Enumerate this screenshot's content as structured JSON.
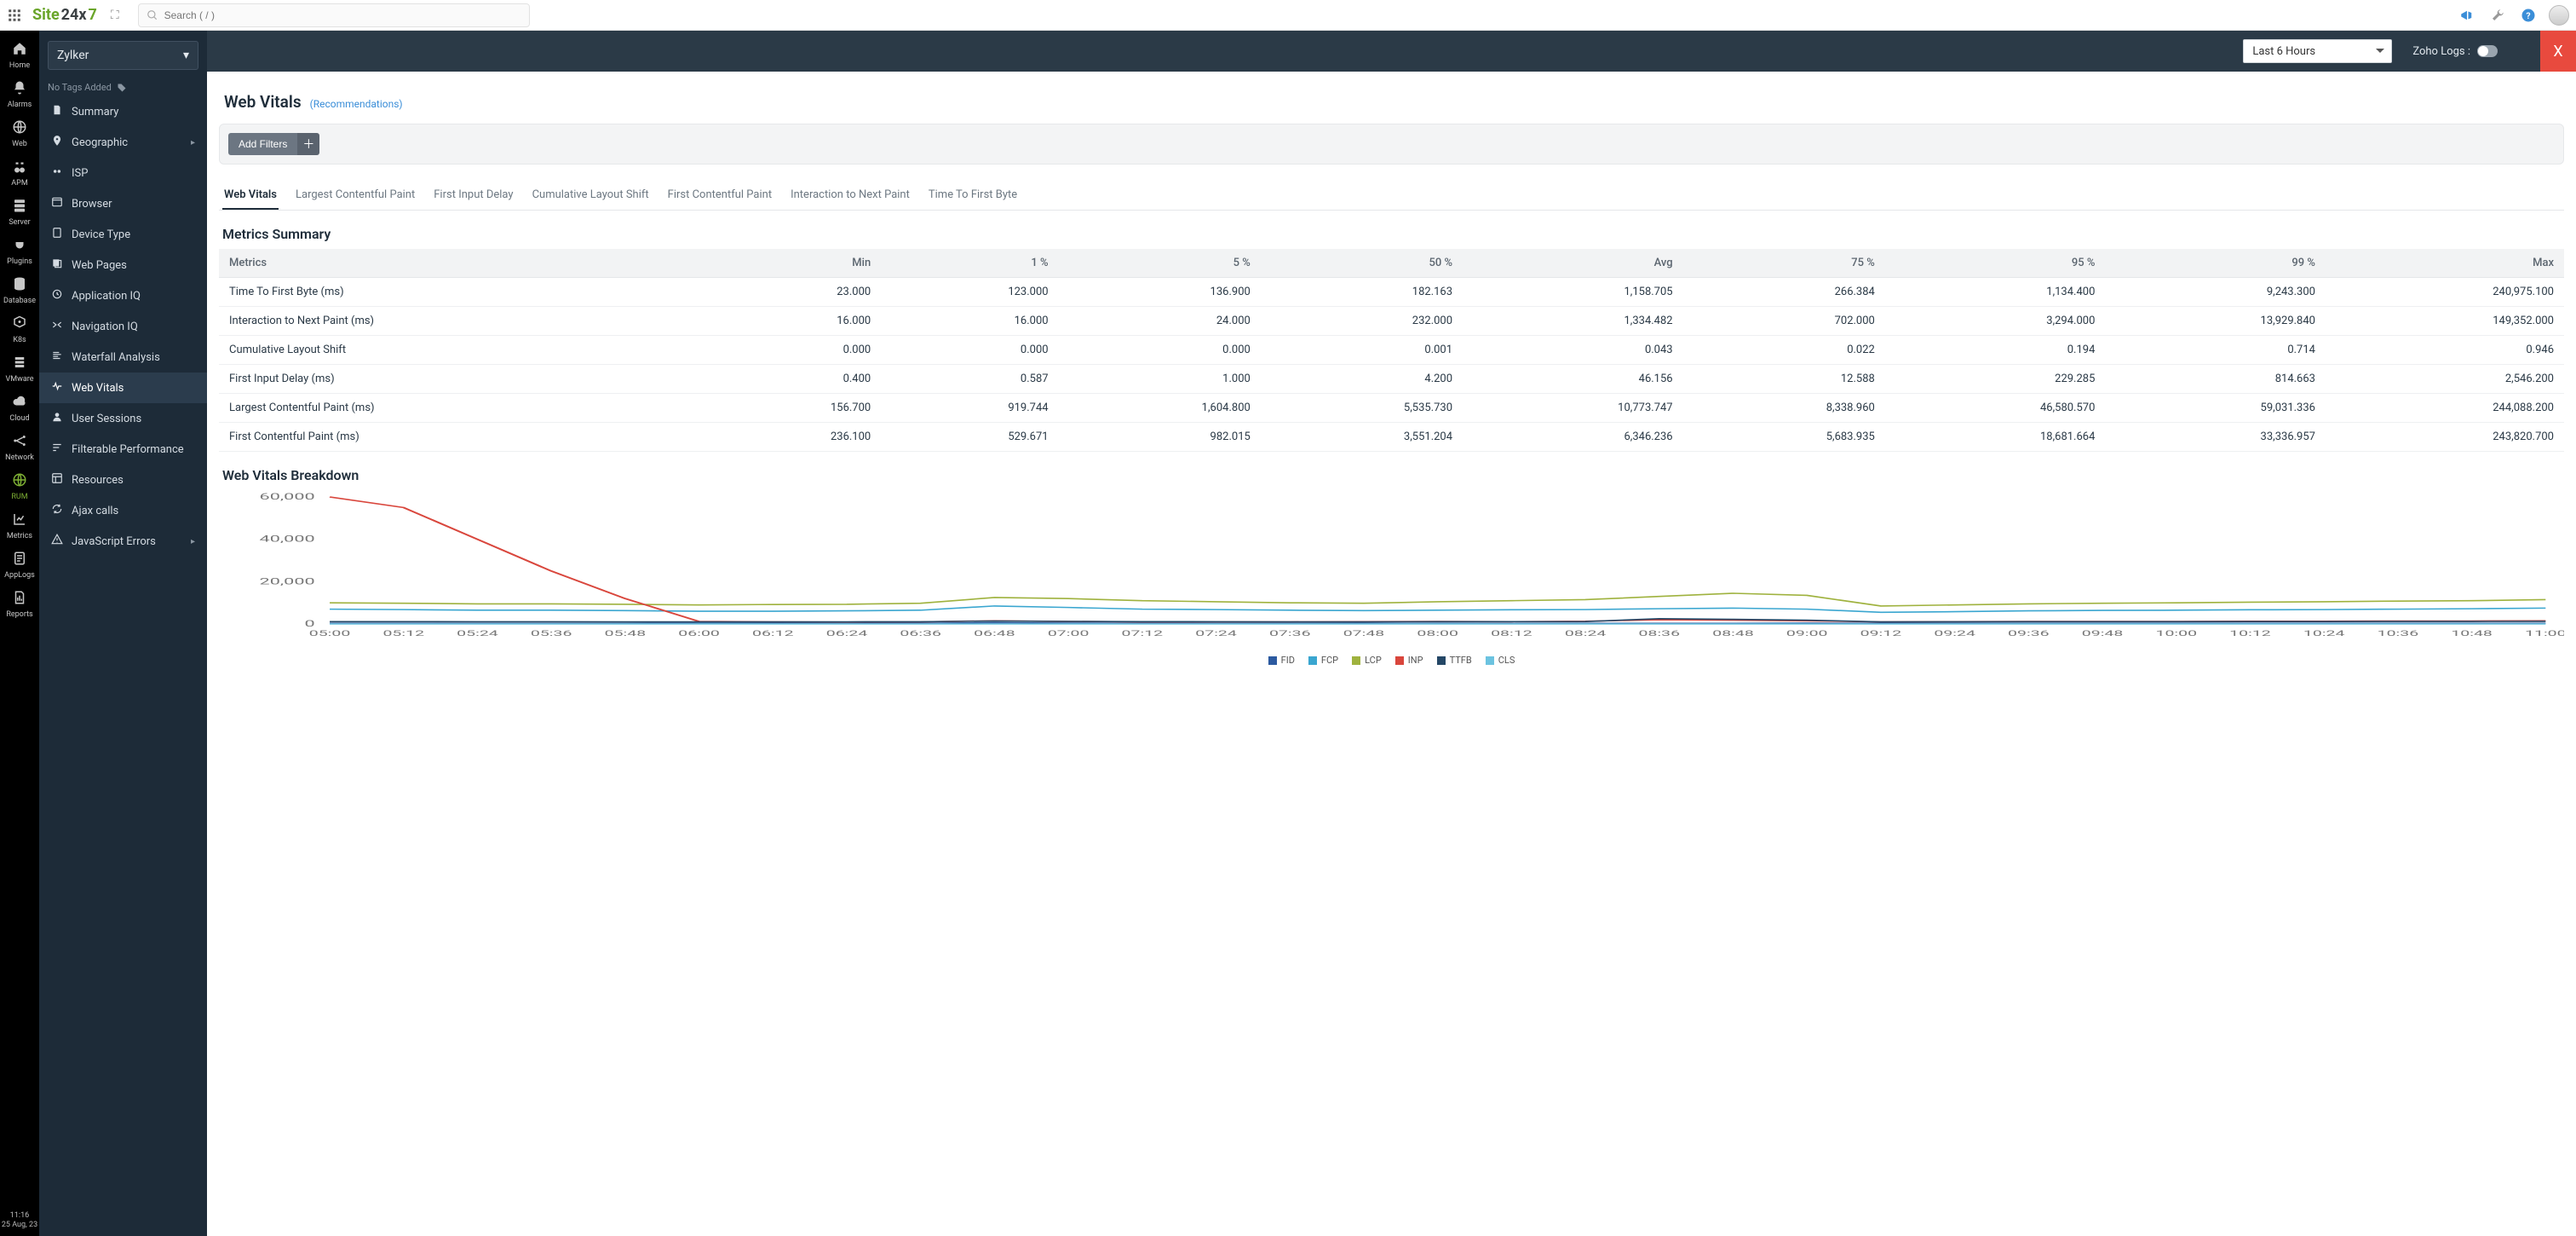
{
  "header": {
    "brand_a": "Site",
    "brand_b": "24x",
    "brand_c": "7",
    "search_placeholder": "Search ( / )"
  },
  "rail": [
    {
      "label": "Home",
      "icon": "home"
    },
    {
      "label": "Alarms",
      "icon": "bell"
    },
    {
      "label": "Web",
      "icon": "globe"
    },
    {
      "label": "APM",
      "icon": "binoc"
    },
    {
      "label": "Server",
      "icon": "server"
    },
    {
      "label": "Plugins",
      "icon": "plug"
    },
    {
      "label": "Database",
      "icon": "db"
    },
    {
      "label": "K8s",
      "icon": "k8s"
    },
    {
      "label": "VMware",
      "icon": "stack"
    },
    {
      "label": "Cloud",
      "icon": "cloud"
    },
    {
      "label": "Network",
      "icon": "net"
    },
    {
      "label": "RUM",
      "icon": "globe",
      "active": true
    },
    {
      "label": "Metrics",
      "icon": "metrics"
    },
    {
      "label": "AppLogs",
      "icon": "logs"
    },
    {
      "label": "Reports",
      "icon": "report"
    }
  ],
  "rail_footer": {
    "time": "11:16",
    "date": "25 Aug, 23"
  },
  "side": {
    "selected_app": "Zylker",
    "no_tags": "No Tags Added",
    "items": [
      {
        "label": "Summary",
        "icon": "doc"
      },
      {
        "label": "Geographic",
        "icon": "pin",
        "caret": true
      },
      {
        "label": "ISP",
        "icon": "isp"
      },
      {
        "label": "Browser",
        "icon": "browser"
      },
      {
        "label": "Device Type",
        "icon": "device"
      },
      {
        "label": "Web Pages",
        "icon": "pages"
      },
      {
        "label": "Application IQ",
        "icon": "iq"
      },
      {
        "label": "Navigation IQ",
        "icon": "naviq"
      },
      {
        "label": "Waterfall Analysis",
        "icon": "water"
      },
      {
        "label": "Web Vitals",
        "icon": "vitals",
        "active": true
      },
      {
        "label": "User Sessions",
        "icon": "user"
      },
      {
        "label": "Filterable Performance",
        "icon": "filter"
      },
      {
        "label": "Resources",
        "icon": "res"
      },
      {
        "label": "Ajax calls",
        "icon": "ajax"
      },
      {
        "label": "JavaScript Errors",
        "icon": "js",
        "caret": true
      }
    ]
  },
  "pagebar": {
    "time_range": "Last 6 Hours",
    "logs_label": "Zoho Logs :",
    "close": "X"
  },
  "page": {
    "title": "Web Vitals",
    "recommendations": "(Recommendations)",
    "add_filters": "Add Filters",
    "tabs": [
      "Web Vitals",
      "Largest Contentful Paint",
      "First Input Delay",
      "Cumulative Layout Shift",
      "First Contentful Paint",
      "Interaction to Next Paint",
      "Time To First Byte"
    ],
    "active_tab": 0,
    "metrics_title": "Metrics Summary",
    "breakdown_title": "Web Vitals Breakdown"
  },
  "metrics_table": {
    "headers": [
      "Metrics",
      "Min",
      "1 %",
      "5 %",
      "50 %",
      "Avg",
      "75 %",
      "95 %",
      "99 %",
      "Max"
    ],
    "rows": [
      [
        "Time To First Byte (ms)",
        "23.000",
        "123.000",
        "136.900",
        "182.163",
        "1,158.705",
        "266.384",
        "1,134.400",
        "9,243.300",
        "240,975.100"
      ],
      [
        "Interaction to Next Paint (ms)",
        "16.000",
        "16.000",
        "24.000",
        "232.000",
        "1,334.482",
        "702.000",
        "3,294.000",
        "13,929.840",
        "149,352.000"
      ],
      [
        "Cumulative Layout Shift",
        "0.000",
        "0.000",
        "0.000",
        "0.001",
        "0.043",
        "0.022",
        "0.194",
        "0.714",
        "0.946"
      ],
      [
        "First Input Delay (ms)",
        "0.400",
        "0.587",
        "1.000",
        "4.200",
        "46.156",
        "12.588",
        "229.285",
        "814.663",
        "2,546.200"
      ],
      [
        "Largest Contentful Paint (ms)",
        "156.700",
        "919.744",
        "1,604.800",
        "5,535.730",
        "10,773.747",
        "8,338.960",
        "46,580.570",
        "59,031.336",
        "244,088.200"
      ],
      [
        "First Contentful Paint (ms)",
        "236.100",
        "529.671",
        "982.015",
        "3,551.204",
        "6,346.236",
        "5,683.935",
        "18,681.664",
        "33,336.957",
        "243,820.700"
      ]
    ]
  },
  "chart_data": {
    "type": "line",
    "title": "Web Vitals Breakdown",
    "ylabel": "",
    "ylim": [
      0,
      60000
    ],
    "yticks": [
      0,
      20000,
      40000,
      60000
    ],
    "x": [
      "05:00",
      "05:12",
      "05:24",
      "05:36",
      "05:48",
      "06:00",
      "06:12",
      "06:24",
      "06:36",
      "06:48",
      "07:00",
      "07:12",
      "07:24",
      "07:36",
      "07:48",
      "08:00",
      "08:12",
      "08:24",
      "08:36",
      "08:48",
      "09:00",
      "09:12",
      "09:24",
      "09:36",
      "09:48",
      "10:00",
      "10:12",
      "10:24",
      "10:36",
      "10:48",
      "11:00"
    ],
    "series": [
      {
        "name": "FID",
        "color": "#2c5aa0",
        "values": [
          300,
          300,
          250,
          250,
          250,
          300,
          300,
          250,
          300,
          600,
          400,
          300,
          250,
          250,
          300,
          300,
          250,
          300,
          300,
          300,
          400,
          300,
          300,
          300,
          300,
          300,
          300,
          300,
          300,
          300,
          300
        ]
      },
      {
        "name": "FCP",
        "color": "#3aa6d0",
        "values": [
          7000,
          6800,
          6500,
          6500,
          6300,
          6000,
          6000,
          6200,
          6500,
          8500,
          7800,
          7000,
          6800,
          6500,
          6300,
          6500,
          6700,
          6800,
          7200,
          7500,
          7000,
          5500,
          5800,
          6200,
          6400,
          6500,
          6700,
          6800,
          7000,
          7200,
          7500
        ]
      },
      {
        "name": "LCP",
        "color": "#9fb23e",
        "values": [
          10000,
          9800,
          9500,
          9500,
          9300,
          9000,
          9200,
          9300,
          9800,
          12500,
          12000,
          11000,
          10500,
          10000,
          9800,
          10500,
          11000,
          11500,
          13000,
          14500,
          13500,
          8500,
          9000,
          9500,
          9800,
          10000,
          10300,
          10500,
          10800,
          11000,
          11500
        ]
      },
      {
        "name": "INP",
        "color": "#d9463c",
        "values": [
          70000,
          55000,
          40000,
          25000,
          12000,
          1200,
          1000,
          900,
          1000,
          1500,
          1200,
          1000,
          1000,
          1000,
          1100,
          1200,
          1100,
          1300,
          2000,
          1800,
          1500,
          1000,
          1100,
          1200,
          1200,
          1200,
          1300,
          1300,
          1400,
          1400,
          1500
        ]
      },
      {
        "name": "TTFB",
        "color": "#244766",
        "values": [
          1100,
          1100,
          1050,
          1050,
          1000,
          1000,
          1000,
          1000,
          1050,
          1400,
          1200,
          1100,
          1050,
          1000,
          1000,
          1100,
          1100,
          1150,
          2500,
          2200,
          1800,
          1000,
          1050,
          1100,
          1100,
          1100,
          1150,
          1150,
          1200,
          1200,
          1250
        ]
      },
      {
        "name": "CLS",
        "color": "#6cc3e0",
        "values": [
          0.04,
          0.04,
          0.04,
          0.04,
          0.04,
          0.04,
          0.04,
          0.04,
          0.04,
          0.05,
          0.04,
          0.04,
          0.04,
          0.04,
          0.04,
          0.04,
          0.04,
          0.04,
          0.05,
          0.05,
          0.04,
          0.04,
          0.04,
          0.04,
          0.04,
          0.04,
          0.04,
          0.04,
          0.04,
          0.04,
          0.04
        ]
      }
    ]
  }
}
